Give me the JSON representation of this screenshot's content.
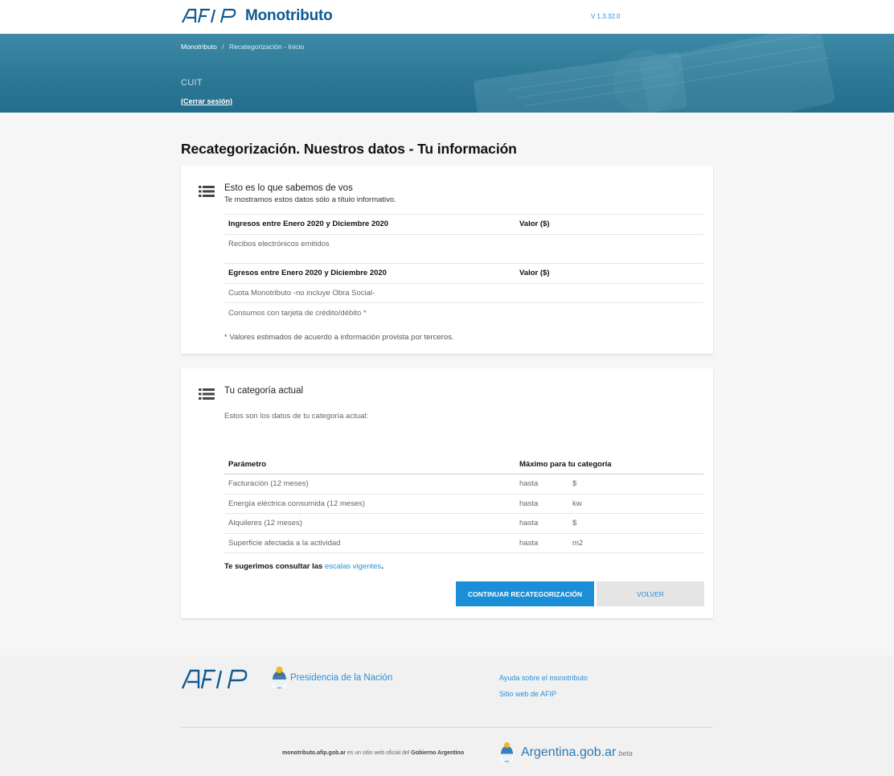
{
  "header": {
    "brand": "Monotributo",
    "version": "V 1.3.32.0"
  },
  "banner": {
    "breadcrumb": [
      "Monotributo",
      "Recategorización - Inicio"
    ],
    "breadcrumb_sep": "/",
    "cuit_label": "CUIT",
    "logout": "(Cerrar sesión)"
  },
  "main": {
    "title": "Recategorización. Nuestros datos - Tu información",
    "card1": {
      "title": "Esto es lo que sabemos de vos",
      "subtitle": "Te mostramos estos datos sólo a título informativo.",
      "income_header": "Ingresos entre Enero 2020 y Diciembre 2020",
      "income_value_header": "Valor ($)",
      "income_rows": [
        "Recibos electrónicos emitidos"
      ],
      "expense_header": "Egresos entre Enero 2020 y Diciembre 2020",
      "expense_value_header": "Valor ($)",
      "expense_rows": [
        "Cuota Monotributo -no incluye Obra Social-",
        "Consumos con tarjeta de crédito/débito *"
      ],
      "note": "* Valores estimados de acuerdo a información provista por terceros."
    },
    "card2": {
      "title": "Tu categoría actual",
      "subtitle": "Estos son los datos de tu categoría actual:",
      "col_param": "Parámetro",
      "col_max": "Máximo para tu categoría",
      "rows": [
        {
          "param": "Facturación (12 meses)",
          "hasta": "hasta",
          "unit": "$"
        },
        {
          "param": "Energía eléctrica consumida (12 meses)",
          "hasta": "hasta",
          "unit": "kw"
        },
        {
          "param": "Alquileres (12 meses)",
          "hasta": "hasta",
          "unit": "$"
        },
        {
          "param": "Superficie afectada a la actividad",
          "hasta": "hasta",
          "unit": "m2"
        }
      ],
      "suggest_prefix": "Te sugerimos consultar las ",
      "suggest_link": "escalas vigentes",
      "suggest_suffix": ".",
      "btn_continue": "CONTINUAR RECATEGORIZACIÓN",
      "btn_back": "VOLVER"
    }
  },
  "footer": {
    "presidencia": "Presidencia de la Nación",
    "links": [
      "Ayuda sobre el monotributo",
      "Sitio web de AFIP"
    ],
    "site_domain": "monotributo.afip.gob.ar",
    "site_mid": " es un sitio web oficial del ",
    "site_gov": "Gobierno Argentino",
    "argentina": "Argentina.gob.ar",
    "beta": "beta"
  },
  "colors": {
    "brand_blue": "#0f5a92",
    "link_blue": "#2a8fd6",
    "primary_button": "#1b8ed8",
    "banner": "#2c7896"
  }
}
